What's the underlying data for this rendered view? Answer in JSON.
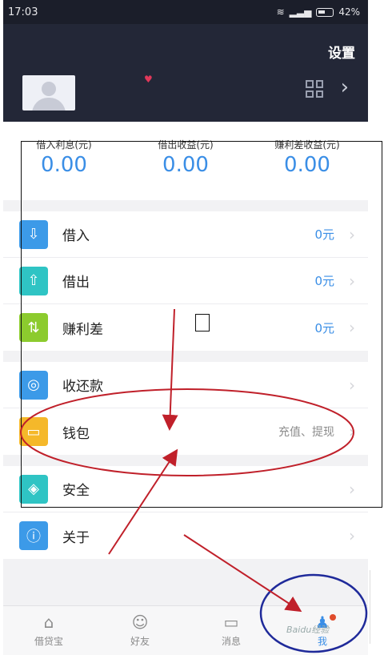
{
  "statusbar": {
    "time": "17:03",
    "battery": "42%"
  },
  "header": {
    "settings_label": "设置"
  },
  "stats": [
    {
      "label": "借入利息(元)",
      "value": "0.00"
    },
    {
      "label": "借出收益(元)",
      "value": "0.00"
    },
    {
      "label": "赚利差收益(元)",
      "value": "0.00"
    }
  ],
  "menu_group1": [
    {
      "label": "借入",
      "value": "0元",
      "icon": "download-icon",
      "color": "#3c9ae8"
    },
    {
      "label": "借出",
      "value": "0元",
      "icon": "upload-icon",
      "color": "#2fc4c4"
    },
    {
      "label": "赚利差",
      "value": "0元",
      "icon": "exchange-icon",
      "color": "#8ccb2e"
    }
  ],
  "menu_group2": [
    {
      "label": "收还款",
      "value": "",
      "icon": "moneybag-icon",
      "color": "#3c9ae8"
    },
    {
      "label": "钱包",
      "value": "充值、提现",
      "icon": "wallet-icon",
      "color": "#f5b82a"
    }
  ],
  "menu_group3": [
    {
      "label": "安全",
      "value": "",
      "icon": "shield-icon",
      "color": "#2fc4c4"
    },
    {
      "label": "关于",
      "value": "",
      "icon": "info-icon",
      "color": "#3c9ae8"
    }
  ],
  "tabbar": [
    {
      "label": "借贷宝",
      "icon": "home-icon",
      "active": false
    },
    {
      "label": "好友",
      "icon": "friends-icon",
      "active": false
    },
    {
      "label": "消息",
      "icon": "message-icon",
      "active": false
    },
    {
      "label": "我",
      "icon": "me-icon",
      "active": true
    }
  ],
  "watermark": "Baidu经验",
  "colors": {
    "accent": "#3a8ee6",
    "header": "#232737",
    "annotation": "#c0202a",
    "circle": "#1f2a9a"
  }
}
